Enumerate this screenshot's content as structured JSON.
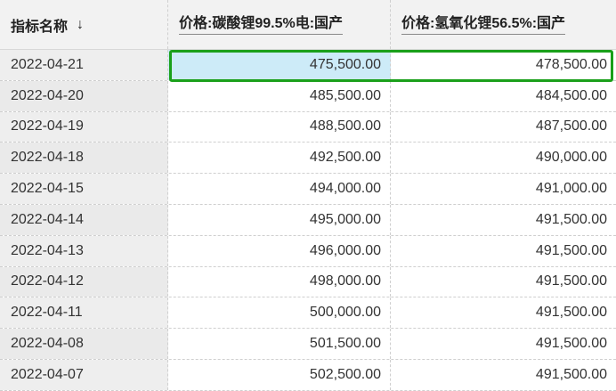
{
  "header": {
    "col0": "指标名称",
    "col1": "价格:碳酸锂99.5%电:国产",
    "col2": "价格:氢氧化锂56.5%:国产",
    "sort_icon": "arrow-down-icon",
    "sort_glyph": "↓"
  },
  "rows": [
    {
      "date": "2022-04-21",
      "v1": "475,500.00",
      "v2": "478,500.00"
    },
    {
      "date": "2022-04-20",
      "v1": "485,500.00",
      "v2": "484,500.00"
    },
    {
      "date": "2022-04-19",
      "v1": "488,500.00",
      "v2": "487,500.00"
    },
    {
      "date": "2022-04-18",
      "v1": "492,500.00",
      "v2": "490,000.00"
    },
    {
      "date": "2022-04-15",
      "v1": "494,000.00",
      "v2": "491,000.00"
    },
    {
      "date": "2022-04-14",
      "v1": "495,000.00",
      "v2": "491,500.00"
    },
    {
      "date": "2022-04-13",
      "v1": "496,000.00",
      "v2": "491,500.00"
    },
    {
      "date": "2022-04-12",
      "v1": "498,000.00",
      "v2": "491,500.00"
    },
    {
      "date": "2022-04-11",
      "v1": "500,000.00",
      "v2": "491,500.00"
    },
    {
      "date": "2022-04-08",
      "v1": "501,500.00",
      "v2": "491,500.00"
    },
    {
      "date": "2022-04-07",
      "v1": "502,500.00",
      "v2": "491,500.00"
    }
  ],
  "colors": {
    "selection_border": "#1aa01a",
    "selected_cell_bg": "#cdebf8"
  }
}
